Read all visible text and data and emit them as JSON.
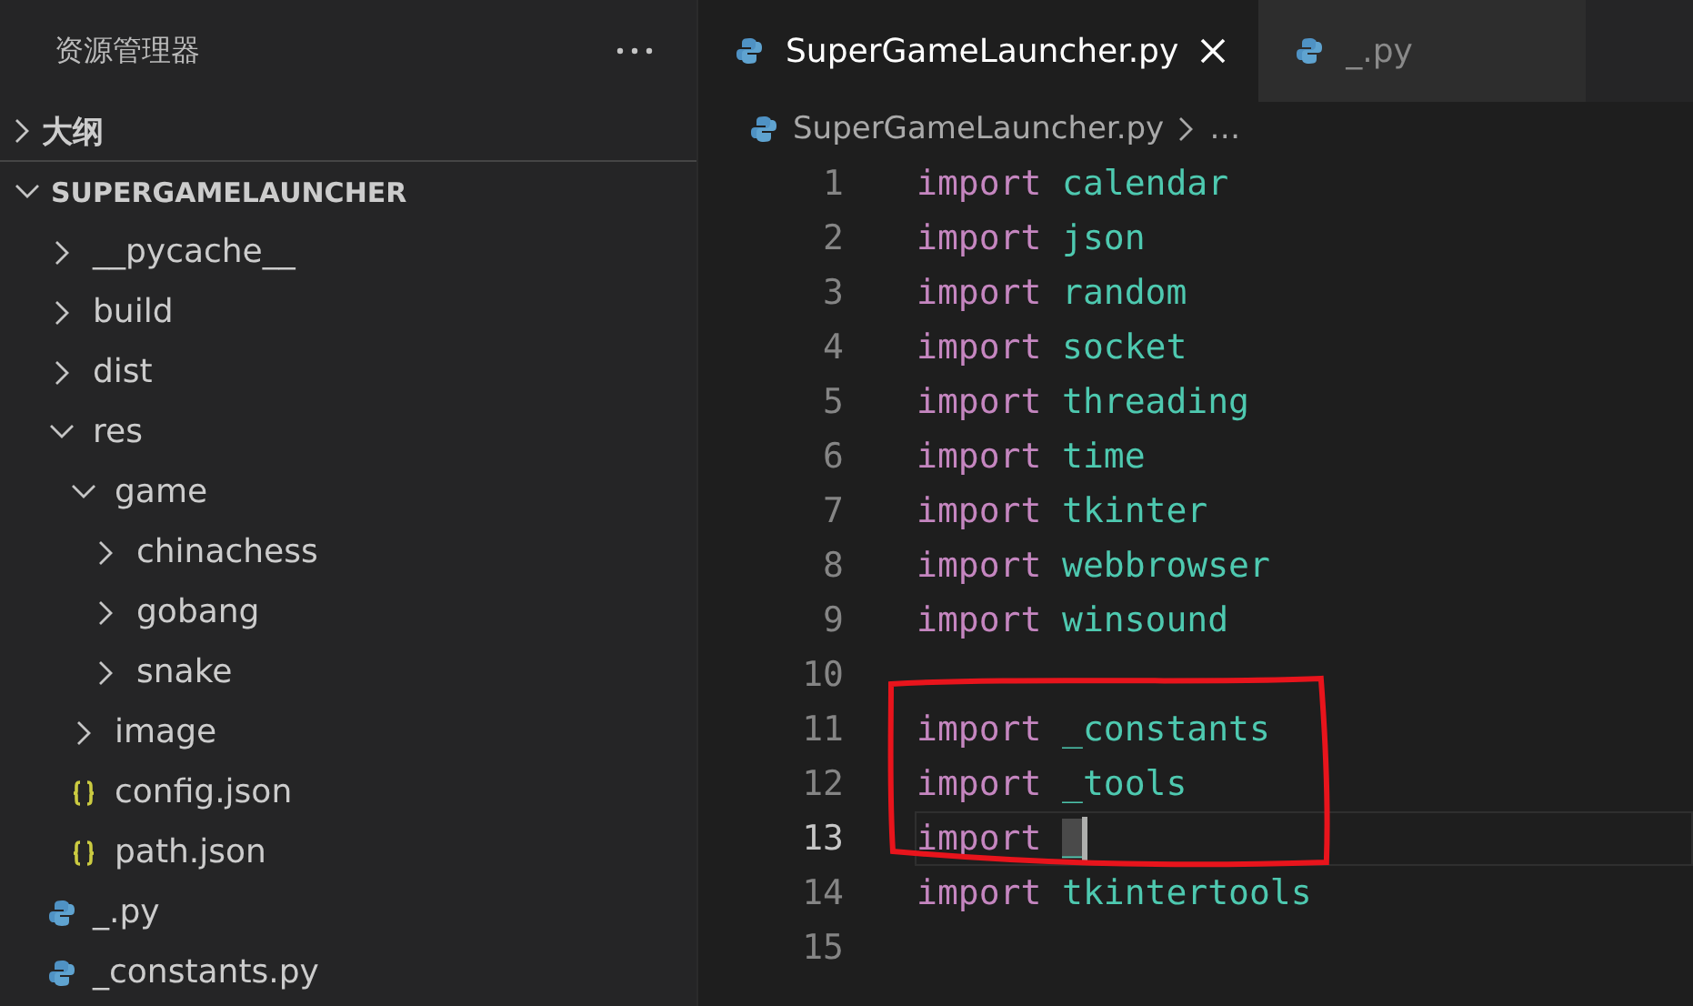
{
  "sidebar": {
    "title": "资源管理器",
    "sections": [
      {
        "label": "大纲",
        "expanded": false
      }
    ],
    "project": {
      "label": "SUPERGAMELAUNCHER",
      "expanded": true
    },
    "tree": [
      {
        "label": "__pycache__",
        "kind": "folder",
        "expanded": false
      },
      {
        "label": "build",
        "kind": "folder",
        "expanded": false
      },
      {
        "label": "dist",
        "kind": "folder",
        "expanded": false
      },
      {
        "label": "res",
        "kind": "folder",
        "expanded": true,
        "children": [
          {
            "label": "game",
            "kind": "folder",
            "expanded": true,
            "children": [
              {
                "label": "chinachess",
                "kind": "folder",
                "expanded": false
              },
              {
                "label": "gobang",
                "kind": "folder",
                "expanded": false
              },
              {
                "label": "snake",
                "kind": "folder",
                "expanded": false
              }
            ]
          },
          {
            "label": "image",
            "kind": "folder",
            "expanded": false
          },
          {
            "label": "config.json",
            "kind": "json"
          },
          {
            "label": "path.json",
            "kind": "json"
          }
        ]
      },
      {
        "label": "_.py",
        "kind": "python"
      },
      {
        "label": "_constants.py",
        "kind": "python"
      }
    ]
  },
  "editor": {
    "tabs": [
      {
        "label": "SuperGameLauncher.py",
        "selected": true
      },
      {
        "label": "_.py",
        "selected": false
      }
    ],
    "breadcrumb": {
      "file": "SuperGameLauncher.py",
      "more": "…"
    },
    "lines": [
      {
        "number": "1",
        "tokens": [
          {
            "kind": "keyword",
            "text": "import"
          },
          {
            "kind": "module",
            "text": "calendar"
          }
        ],
        "current": false,
        "circled": false
      },
      {
        "number": "2",
        "tokens": [
          {
            "kind": "keyword",
            "text": "import"
          },
          {
            "kind": "module",
            "text": "json"
          }
        ],
        "current": false,
        "circled": false
      },
      {
        "number": "3",
        "tokens": [
          {
            "kind": "keyword",
            "text": "import"
          },
          {
            "kind": "module",
            "text": "random"
          }
        ],
        "current": false,
        "circled": false
      },
      {
        "number": "4",
        "tokens": [
          {
            "kind": "keyword",
            "text": "import"
          },
          {
            "kind": "module",
            "text": "socket"
          }
        ],
        "current": false,
        "circled": false
      },
      {
        "number": "5",
        "tokens": [
          {
            "kind": "keyword",
            "text": "import"
          },
          {
            "kind": "module",
            "text": "threading"
          }
        ],
        "current": false,
        "circled": false
      },
      {
        "number": "6",
        "tokens": [
          {
            "kind": "keyword",
            "text": "import"
          },
          {
            "kind": "module",
            "text": "time"
          }
        ],
        "current": false,
        "circled": false
      },
      {
        "number": "7",
        "tokens": [
          {
            "kind": "keyword",
            "text": "import"
          },
          {
            "kind": "module",
            "text": "tkinter"
          }
        ],
        "current": false,
        "circled": false
      },
      {
        "number": "8",
        "tokens": [
          {
            "kind": "keyword",
            "text": "import"
          },
          {
            "kind": "module",
            "text": "webbrowser"
          }
        ],
        "current": false,
        "circled": false
      },
      {
        "number": "9",
        "tokens": [
          {
            "kind": "keyword",
            "text": "import"
          },
          {
            "kind": "module",
            "text": "winsound"
          }
        ],
        "current": false,
        "circled": false
      },
      {
        "number": "10",
        "current": false,
        "circled": false
      },
      {
        "number": "11",
        "tokens": [
          {
            "kind": "keyword",
            "text": "import"
          },
          {
            "kind": "module",
            "text": "_constants"
          }
        ],
        "current": false,
        "circled": true
      },
      {
        "number": "12",
        "tokens": [
          {
            "kind": "keyword",
            "text": "import"
          },
          {
            "kind": "module",
            "text": "_tools"
          }
        ],
        "current": false,
        "circled": true
      },
      {
        "number": "13",
        "tokens": [
          {
            "kind": "keyword",
            "text": "import"
          },
          {
            "kind": "module",
            "text": "_"
          }
        ],
        "current": true,
        "circled": true
      },
      {
        "number": "14",
        "tokens": [
          {
            "kind": "keyword",
            "text": "import"
          },
          {
            "kind": "module",
            "text": "tkintertools"
          }
        ],
        "current": false,
        "circled": false
      },
      {
        "number": "15",
        "current": false,
        "circled": false
      }
    ]
  }
}
